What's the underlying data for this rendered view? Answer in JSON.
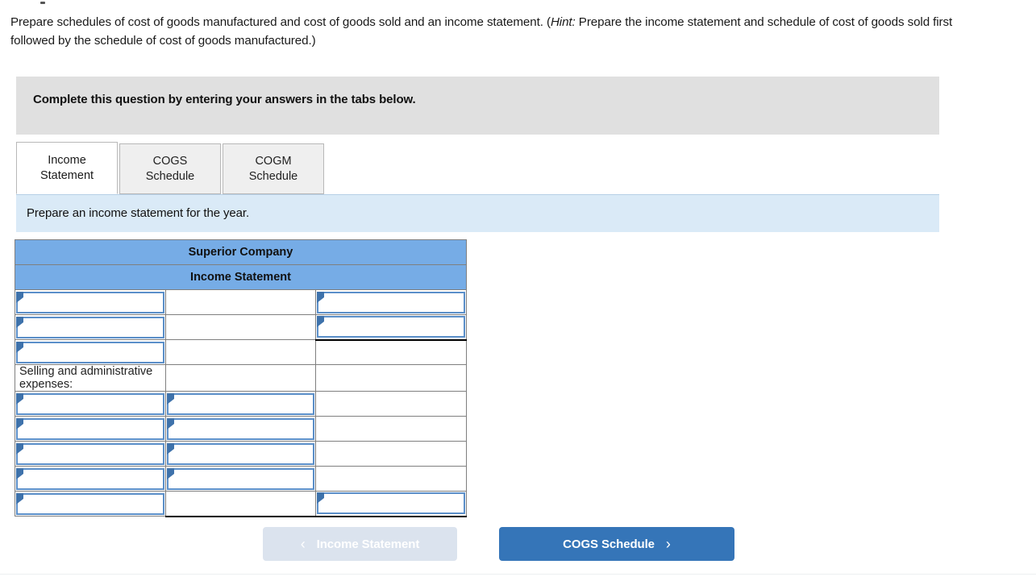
{
  "prompt": {
    "part1": "Prepare schedules of cost of goods manufactured and cost of goods sold and an income statement. (",
    "hint_label": "Hint:",
    "part2": " Prepare the income statement and schedule of cost of goods sold first followed by the schedule of cost of goods manufactured.)"
  },
  "banner": {
    "text": "Complete this question by entering your answers in the tabs below."
  },
  "tabs": [
    {
      "id": "income-statement",
      "label": "Income\nStatement",
      "line1": "Income",
      "line2": "Statement",
      "active": true
    },
    {
      "id": "cogs-schedule",
      "label": "COGS\nSchedule",
      "line1": "COGS",
      "line2": "Schedule",
      "active": false
    },
    {
      "id": "cogm-schedule",
      "label": "COGM\nSchedule",
      "line1": "COGM",
      "line2": "Schedule",
      "active": false
    }
  ],
  "instruction": {
    "text": "Prepare an income statement for the year."
  },
  "worksheet": {
    "title_line1": "Superior Company",
    "title_line2": "Income Statement",
    "section_label": "Selling and administrative expenses:",
    "rows": [
      {
        "index": 0,
        "col1": "input",
        "col1_value": "",
        "col2": "empty",
        "col2_value": "",
        "col3": "input",
        "col3_value": "",
        "col3_bottom_rule": false
      },
      {
        "index": 1,
        "col1": "input",
        "col1_value": "",
        "col2": "empty",
        "col2_value": "",
        "col3": "input",
        "col3_value": "",
        "col3_bottom_rule": true
      },
      {
        "index": 2,
        "col1": "input",
        "col1_value": "",
        "col2": "empty",
        "col2_value": "",
        "col3": "empty",
        "col3_value": "",
        "col3_bottom_rule": false
      },
      {
        "index": 3,
        "col1": "label",
        "col1_value": "Selling and administrative expenses:",
        "col2": "empty",
        "col2_value": "",
        "col3": "empty",
        "col3_value": "",
        "col3_bottom_rule": false
      },
      {
        "index": 4,
        "col1": "input",
        "col1_value": "",
        "col2": "input",
        "col2_value": "",
        "col3": "empty",
        "col3_value": "",
        "col3_bottom_rule": false
      },
      {
        "index": 5,
        "col1": "input",
        "col1_value": "",
        "col2": "input",
        "col2_value": "",
        "col3": "empty",
        "col3_value": "",
        "col3_bottom_rule": false
      },
      {
        "index": 6,
        "col1": "input",
        "col1_value": "",
        "col2": "input",
        "col2_value": "",
        "col3": "empty",
        "col3_value": "",
        "col3_bottom_rule": false
      },
      {
        "index": 7,
        "col1": "input",
        "col1_value": "",
        "col2": "input",
        "col2_value": "",
        "col3": "empty",
        "col3_value": "",
        "col3_bottom_rule": false
      },
      {
        "index": 8,
        "col1": "input",
        "col1_value": "",
        "col2": "empty",
        "col2_value": "",
        "col3": "input",
        "col3_value": "",
        "col3_bottom_rule": true
      }
    ]
  },
  "nav": {
    "prev_label": "Income Statement",
    "prev_icon": "chevron-left-icon",
    "prev_glyph": "‹",
    "prev_disabled": true,
    "next_label": "COGS Schedule",
    "next_icon": "chevron-right-icon",
    "next_glyph": "›",
    "next_disabled": false
  },
  "colors": {
    "header_blue": "#76ace6",
    "strip_blue": "#daeaf7",
    "band_gray": "#e0e0e0",
    "button_blue": "#3575b8",
    "button_disabled": "#dbe3ee",
    "input_border": "#5b8fc9",
    "flag_blue": "#3e72ab"
  }
}
